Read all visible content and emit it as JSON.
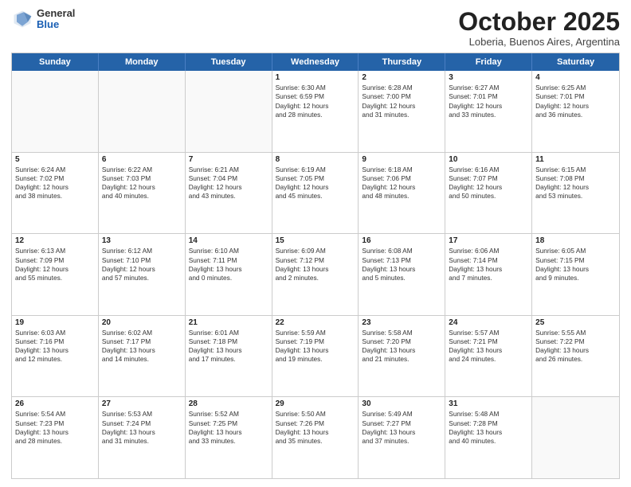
{
  "header": {
    "logo": {
      "general": "General",
      "blue": "Blue"
    },
    "title": "October 2025",
    "location": "Loberia, Buenos Aires, Argentina"
  },
  "weekdays": [
    "Sunday",
    "Monday",
    "Tuesday",
    "Wednesday",
    "Thursday",
    "Friday",
    "Saturday"
  ],
  "rows": [
    [
      {
        "day": "",
        "lines": []
      },
      {
        "day": "",
        "lines": []
      },
      {
        "day": "",
        "lines": []
      },
      {
        "day": "1",
        "lines": [
          "Sunrise: 6:30 AM",
          "Sunset: 6:59 PM",
          "Daylight: 12 hours",
          "and 28 minutes."
        ]
      },
      {
        "day": "2",
        "lines": [
          "Sunrise: 6:28 AM",
          "Sunset: 7:00 PM",
          "Daylight: 12 hours",
          "and 31 minutes."
        ]
      },
      {
        "day": "3",
        "lines": [
          "Sunrise: 6:27 AM",
          "Sunset: 7:01 PM",
          "Daylight: 12 hours",
          "and 33 minutes."
        ]
      },
      {
        "day": "4",
        "lines": [
          "Sunrise: 6:25 AM",
          "Sunset: 7:01 PM",
          "Daylight: 12 hours",
          "and 36 minutes."
        ]
      }
    ],
    [
      {
        "day": "5",
        "lines": [
          "Sunrise: 6:24 AM",
          "Sunset: 7:02 PM",
          "Daylight: 12 hours",
          "and 38 minutes."
        ]
      },
      {
        "day": "6",
        "lines": [
          "Sunrise: 6:22 AM",
          "Sunset: 7:03 PM",
          "Daylight: 12 hours",
          "and 40 minutes."
        ]
      },
      {
        "day": "7",
        "lines": [
          "Sunrise: 6:21 AM",
          "Sunset: 7:04 PM",
          "Daylight: 12 hours",
          "and 43 minutes."
        ]
      },
      {
        "day": "8",
        "lines": [
          "Sunrise: 6:19 AM",
          "Sunset: 7:05 PM",
          "Daylight: 12 hours",
          "and 45 minutes."
        ]
      },
      {
        "day": "9",
        "lines": [
          "Sunrise: 6:18 AM",
          "Sunset: 7:06 PM",
          "Daylight: 12 hours",
          "and 48 minutes."
        ]
      },
      {
        "day": "10",
        "lines": [
          "Sunrise: 6:16 AM",
          "Sunset: 7:07 PM",
          "Daylight: 12 hours",
          "and 50 minutes."
        ]
      },
      {
        "day": "11",
        "lines": [
          "Sunrise: 6:15 AM",
          "Sunset: 7:08 PM",
          "Daylight: 12 hours",
          "and 53 minutes."
        ]
      }
    ],
    [
      {
        "day": "12",
        "lines": [
          "Sunrise: 6:13 AM",
          "Sunset: 7:09 PM",
          "Daylight: 12 hours",
          "and 55 minutes."
        ]
      },
      {
        "day": "13",
        "lines": [
          "Sunrise: 6:12 AM",
          "Sunset: 7:10 PM",
          "Daylight: 12 hours",
          "and 57 minutes."
        ]
      },
      {
        "day": "14",
        "lines": [
          "Sunrise: 6:10 AM",
          "Sunset: 7:11 PM",
          "Daylight: 13 hours",
          "and 0 minutes."
        ]
      },
      {
        "day": "15",
        "lines": [
          "Sunrise: 6:09 AM",
          "Sunset: 7:12 PM",
          "Daylight: 13 hours",
          "and 2 minutes."
        ]
      },
      {
        "day": "16",
        "lines": [
          "Sunrise: 6:08 AM",
          "Sunset: 7:13 PM",
          "Daylight: 13 hours",
          "and 5 minutes."
        ]
      },
      {
        "day": "17",
        "lines": [
          "Sunrise: 6:06 AM",
          "Sunset: 7:14 PM",
          "Daylight: 13 hours",
          "and 7 minutes."
        ]
      },
      {
        "day": "18",
        "lines": [
          "Sunrise: 6:05 AM",
          "Sunset: 7:15 PM",
          "Daylight: 13 hours",
          "and 9 minutes."
        ]
      }
    ],
    [
      {
        "day": "19",
        "lines": [
          "Sunrise: 6:03 AM",
          "Sunset: 7:16 PM",
          "Daylight: 13 hours",
          "and 12 minutes."
        ]
      },
      {
        "day": "20",
        "lines": [
          "Sunrise: 6:02 AM",
          "Sunset: 7:17 PM",
          "Daylight: 13 hours",
          "and 14 minutes."
        ]
      },
      {
        "day": "21",
        "lines": [
          "Sunrise: 6:01 AM",
          "Sunset: 7:18 PM",
          "Daylight: 13 hours",
          "and 17 minutes."
        ]
      },
      {
        "day": "22",
        "lines": [
          "Sunrise: 5:59 AM",
          "Sunset: 7:19 PM",
          "Daylight: 13 hours",
          "and 19 minutes."
        ]
      },
      {
        "day": "23",
        "lines": [
          "Sunrise: 5:58 AM",
          "Sunset: 7:20 PM",
          "Daylight: 13 hours",
          "and 21 minutes."
        ]
      },
      {
        "day": "24",
        "lines": [
          "Sunrise: 5:57 AM",
          "Sunset: 7:21 PM",
          "Daylight: 13 hours",
          "and 24 minutes."
        ]
      },
      {
        "day": "25",
        "lines": [
          "Sunrise: 5:55 AM",
          "Sunset: 7:22 PM",
          "Daylight: 13 hours",
          "and 26 minutes."
        ]
      }
    ],
    [
      {
        "day": "26",
        "lines": [
          "Sunrise: 5:54 AM",
          "Sunset: 7:23 PM",
          "Daylight: 13 hours",
          "and 28 minutes."
        ]
      },
      {
        "day": "27",
        "lines": [
          "Sunrise: 5:53 AM",
          "Sunset: 7:24 PM",
          "Daylight: 13 hours",
          "and 31 minutes."
        ]
      },
      {
        "day": "28",
        "lines": [
          "Sunrise: 5:52 AM",
          "Sunset: 7:25 PM",
          "Daylight: 13 hours",
          "and 33 minutes."
        ]
      },
      {
        "day": "29",
        "lines": [
          "Sunrise: 5:50 AM",
          "Sunset: 7:26 PM",
          "Daylight: 13 hours",
          "and 35 minutes."
        ]
      },
      {
        "day": "30",
        "lines": [
          "Sunrise: 5:49 AM",
          "Sunset: 7:27 PM",
          "Daylight: 13 hours",
          "and 37 minutes."
        ]
      },
      {
        "day": "31",
        "lines": [
          "Sunrise: 5:48 AM",
          "Sunset: 7:28 PM",
          "Daylight: 13 hours",
          "and 40 minutes."
        ]
      },
      {
        "day": "",
        "lines": []
      }
    ]
  ]
}
